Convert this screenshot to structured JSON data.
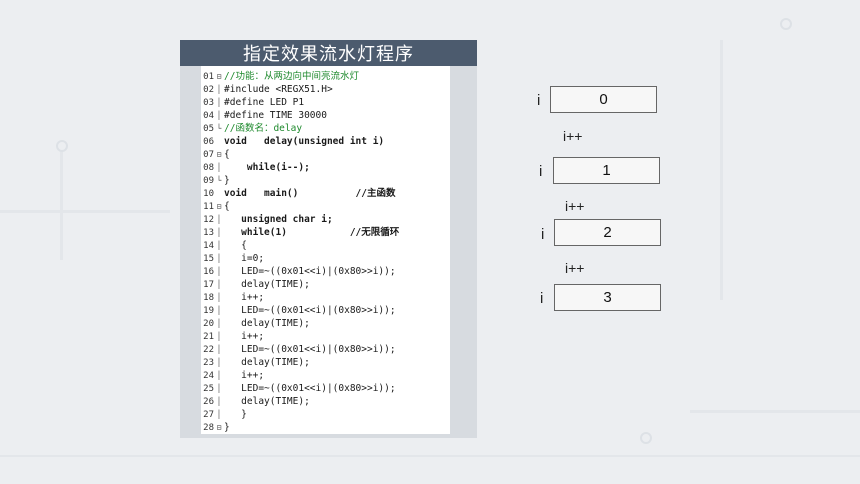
{
  "panel_title": "指定效果流水灯程序",
  "code_lines": [
    {
      "n": "01",
      "fold": "⊟",
      "text": "//功能：从两边向中间亮流水灯",
      "style": "c"
    },
    {
      "n": "02",
      "fold": "│",
      "text": "#include <REGX51.H>",
      "style": ""
    },
    {
      "n": "03",
      "fold": "│",
      "text": "#define LED P1",
      "style": ""
    },
    {
      "n": "04",
      "fold": "│",
      "text": "#define TIME 30000",
      "style": ""
    },
    {
      "n": "05",
      "fold": "└",
      "text": "//函数名：delay",
      "style": "c"
    },
    {
      "n": "06",
      "fold": "",
      "text": "void   delay(unsigned int i)",
      "style": "b"
    },
    {
      "n": "07",
      "fold": "⊟",
      "text": "{",
      "style": ""
    },
    {
      "n": "08",
      "fold": "│",
      "text": "    while(i--);",
      "style": "b"
    },
    {
      "n": "09",
      "fold": "└",
      "text": "}",
      "style": ""
    },
    {
      "n": "10",
      "fold": "",
      "text": "void   main()          //主函数",
      "style": "b"
    },
    {
      "n": "11",
      "fold": "⊟",
      "text": "{",
      "style": ""
    },
    {
      "n": "12",
      "fold": "│",
      "text": "   unsigned char i;",
      "style": "b"
    },
    {
      "n": "13",
      "fold": "│",
      "text": "   while(1)           //无限循环",
      "style": "b"
    },
    {
      "n": "14",
      "fold": "│",
      "text": "   {",
      "style": ""
    },
    {
      "n": "15",
      "fold": "│",
      "text": "   i=0;",
      "style": ""
    },
    {
      "n": "16",
      "fold": "│",
      "text": "   LED=~((0x01<<i)|(0x80>>i));",
      "style": ""
    },
    {
      "n": "17",
      "fold": "│",
      "text": "   delay(TIME);",
      "style": ""
    },
    {
      "n": "18",
      "fold": "│",
      "text": "   i++;",
      "style": ""
    },
    {
      "n": "19",
      "fold": "│",
      "text": "   LED=~((0x01<<i)|(0x80>>i));",
      "style": ""
    },
    {
      "n": "20",
      "fold": "│",
      "text": "   delay(TIME);",
      "style": ""
    },
    {
      "n": "21",
      "fold": "│",
      "text": "   i++;",
      "style": ""
    },
    {
      "n": "22",
      "fold": "│",
      "text": "   LED=~((0x01<<i)|(0x80>>i));",
      "style": ""
    },
    {
      "n": "23",
      "fold": "│",
      "text": "   delay(TIME);",
      "style": ""
    },
    {
      "n": "24",
      "fold": "│",
      "text": "   i++;",
      "style": ""
    },
    {
      "n": "25",
      "fold": "│",
      "text": "   LED=~((0x01<<i)|(0x80>>i));",
      "style": ""
    },
    {
      "n": "26",
      "fold": "│",
      "text": "   delay(TIME);",
      "style": ""
    },
    {
      "n": "27",
      "fold": "│",
      "text": "   }",
      "style": ""
    },
    {
      "n": "28",
      "fold": "⊟",
      "text": "}",
      "style": ""
    }
  ],
  "variable_name": "i",
  "increment_label": "i++",
  "values": [
    "0",
    "1",
    "2",
    "3"
  ]
}
